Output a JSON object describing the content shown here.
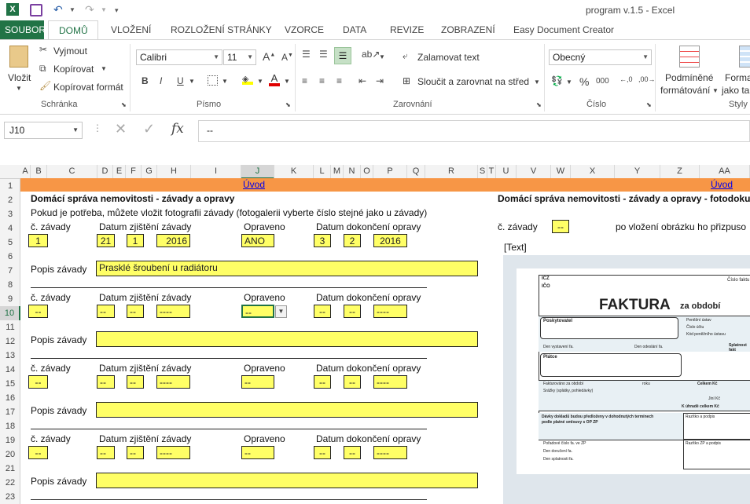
{
  "window": {
    "title": "program v.1.5 - Excel"
  },
  "tabs": {
    "file": "SOUBOR",
    "home": "DOMŮ",
    "insert": "VLOŽENÍ",
    "layout": "ROZLOŽENÍ STRÁNKY",
    "formulas": "VZORCE",
    "data": "DATA",
    "review": "REVIZE",
    "view": "ZOBRAZENÍ",
    "easydoc": "Easy Document Creator"
  },
  "clipboard": {
    "paste": "Vložit",
    "cut": "Vyjmout",
    "copy": "Kopírovat",
    "painter": "Kopírovat formát",
    "group": "Schránka"
  },
  "font": {
    "name": "Calibri",
    "size": "11",
    "group": "Písmo",
    "bold": "B",
    "italic": "I",
    "underline": "U"
  },
  "alignment": {
    "wrap": "Zalamovat text",
    "merge": "Sloučit a zarovnat na střed",
    "group": "Zarovnání"
  },
  "number": {
    "format": "Obecný",
    "group": "Číslo",
    "percent": "%",
    "thousands": "000"
  },
  "styles": {
    "cond1": "Podmíněné",
    "cond2": "formátování",
    "table": "Forma",
    "tablesub": "jako tabu",
    "group": "Styly"
  },
  "formula": {
    "namebox": "J10",
    "value": "--",
    "fx": "fx"
  },
  "columns": [
    "A",
    "B",
    "C",
    "D",
    "E",
    "F",
    "G",
    "H",
    "I",
    "J",
    "K",
    "L",
    "M",
    "N",
    "O",
    "P",
    "Q",
    "R",
    "S",
    "T",
    "U",
    "V",
    "W",
    "X",
    "Y",
    "Z",
    "AA"
  ],
  "rows": [
    "1",
    "2",
    "3",
    "4",
    "5",
    "6",
    "7",
    "8",
    "9",
    "10",
    "11",
    "12",
    "13",
    "14",
    "15",
    "16",
    "17",
    "18",
    "19",
    "20",
    "21",
    "22",
    "23"
  ],
  "sheet": {
    "link": "Úvod",
    "heading": "Domácí správa nemovitosti - závady a opravy",
    "note": "Pokud je potřeba, můžete vložit fotografii závady (fotogalerii vyberte číslo stejné jako u závady)",
    "lbl_no": "č. závady",
    "lbl_found": "Datum zjištění závady",
    "lbl_fixed": "Opraveno",
    "lbl_done": "Datum dokončení opravy",
    "lbl_desc": "Popis závady",
    "r1": {
      "no": "1",
      "d": "21",
      "m": "1",
      "y": "2016",
      "fixed": "ANO",
      "dd": "3",
      "dm": "2",
      "dy": "2016",
      "desc": "Prasklé šroubení u radiátoru"
    },
    "dash": "--",
    "dash4": "----",
    "right_heading": "Domácí správa nemovitosti - závady a opravy - fotodokume",
    "right_no": "č. závady",
    "right_no_val": "--",
    "right_note": "po vložení obrázku ho přizpuso",
    "text_placeholder": "[Text]"
  },
  "invoice": {
    "title": "FAKTURA",
    "title_sub": "za období",
    "ic": "IČZ",
    "ico": "IČO",
    "no": "Číslo faktu",
    "supplier": "Poskytovatel",
    "pension": "Peněžní ústav",
    "account": "Číslo účtu",
    "bankcode": "Kód peněžního ústavu",
    "issued": "Den vystavení fa.",
    "sent": "Den odeslání fa.",
    "due": "Splatnost fakt",
    "payer": "Plátce",
    "invoiced": "Fakturováno za období",
    "year": "roku",
    "total": "Celkem Kč",
    "disc": "Srážky (splátky, pohledávky)",
    "other": "Jiní Kč",
    "topay": "K úhradě celkem Kč",
    "docs": "Dávky dokladů budou předloženy v dohodnutých termínech podle platné smlouvy s OP ZP",
    "stamp": "Razítko a podpis",
    "order": "Pořadové číslo fa. ve ZP",
    "recv": "Den doručení fa.",
    "paid": "Den splatnosti fa.",
    "stamp2": "Razítko ZP a podpis"
  }
}
